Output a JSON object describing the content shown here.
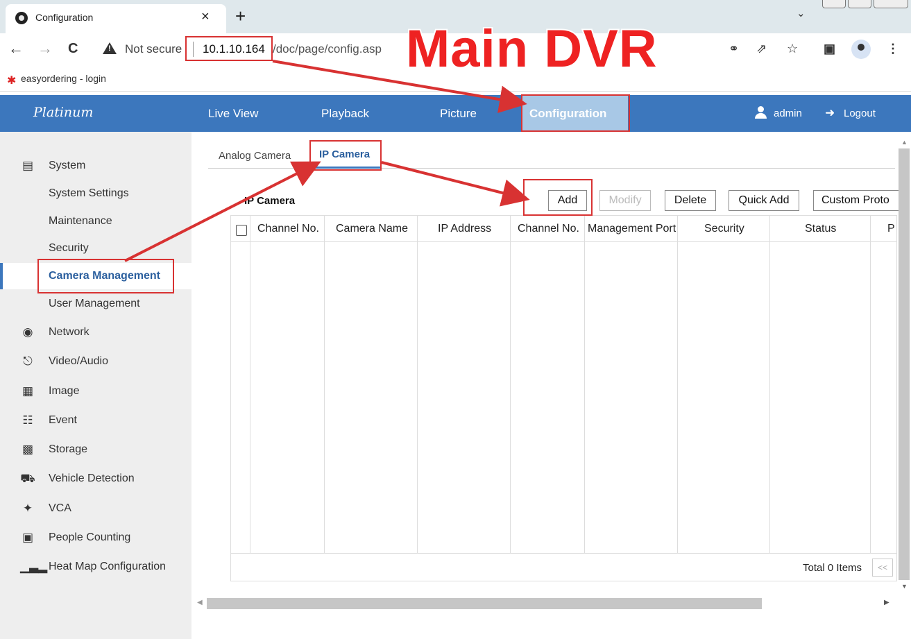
{
  "browser": {
    "tab_title": "Configuration",
    "tab_close": "×",
    "new_tab": "+",
    "security_label": "Not secure",
    "url_host": "10.1.10.164",
    "url_path": "/doc/page/config.asp",
    "bookmark_label": "easyordering - login",
    "nav": {
      "back": "←",
      "forward": "→",
      "reload": "C"
    }
  },
  "annotation": {
    "overlay_text": "Main DVR",
    "accent_color": "#ee2222"
  },
  "header": {
    "logo": "Platinum",
    "nav": [
      "Live View",
      "Playback",
      "Picture",
      "Configuration"
    ],
    "active_nav": "Configuration",
    "user": "admin",
    "logout": "Logout",
    "brand_color": "#3c77bd"
  },
  "sidebar": {
    "items": [
      {
        "label": "System",
        "icon": "monitor-icon"
      },
      {
        "label": "System Settings",
        "sub": true
      },
      {
        "label": "Maintenance",
        "sub": true
      },
      {
        "label": "Security",
        "sub": true
      },
      {
        "label": "Camera Management",
        "sub": true,
        "active": true
      },
      {
        "label": "User Management",
        "sub": true
      },
      {
        "label": "Network",
        "icon": "globe-icon"
      },
      {
        "label": "Video/Audio",
        "icon": "microphone-icon"
      },
      {
        "label": "Image",
        "icon": "image-icon"
      },
      {
        "label": "Event",
        "icon": "calendar-icon"
      },
      {
        "label": "Storage",
        "icon": "disk-icon"
      },
      {
        "label": "Vehicle Detection",
        "icon": "vehicle-icon"
      },
      {
        "label": "VCA",
        "icon": "vca-icon"
      },
      {
        "label": "People Counting",
        "icon": "chart-icon"
      },
      {
        "label": "Heat Map Configuration",
        "icon": "bar-chart-icon"
      }
    ]
  },
  "content": {
    "tabs": [
      "Analog Camera",
      "IP Camera"
    ],
    "active_tab": "IP Camera",
    "section_title": "IP Camera",
    "buttons": [
      "Add",
      "Modify",
      "Delete",
      "Quick Add",
      "Custom Proto"
    ],
    "columns": [
      "Channel No.",
      "Camera Name",
      "IP Address",
      "Channel No.",
      "Management Port",
      "Security",
      "Status",
      "P"
    ],
    "rows": [],
    "total_label": "Total 0 Items",
    "pager_prev": "<<"
  }
}
